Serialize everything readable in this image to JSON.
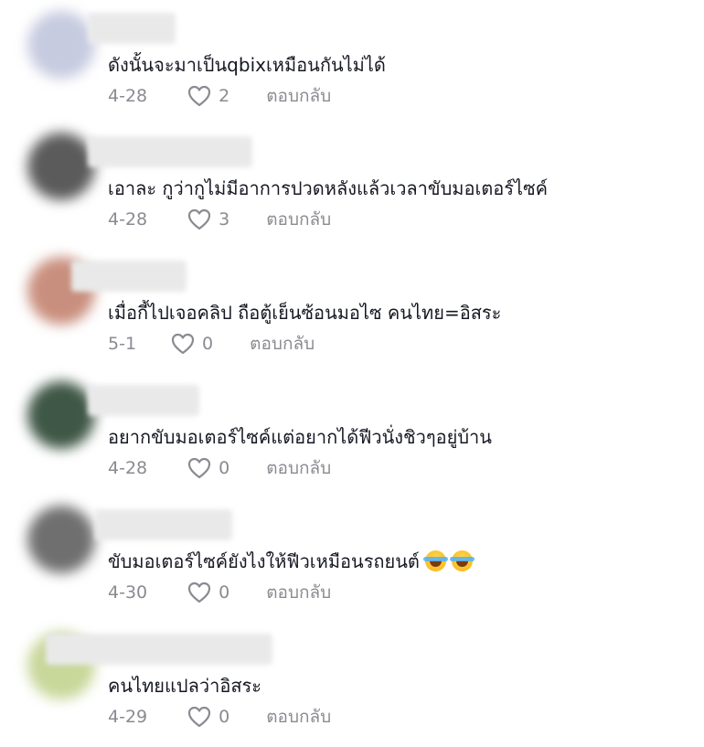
{
  "comments": [
    {
      "text": "ดังนั้นจะมาเป็นqbixเหมือนกันไม่ได้",
      "date": "4-28",
      "likes": "2",
      "reply": "ตอบกลับ"
    },
    {
      "text": "เอาละ กูว่ากูไม่มีอาการปวดหลังแล้วเวลาขับมอเตอร์ไซค์",
      "date": "4-28",
      "likes": "3",
      "reply": "ตอบกลับ"
    },
    {
      "text": "เมื่อกี้ไปเจอคลิป ถือตู้เย็นซ้อนมอไซ คนไทย=อิสระ",
      "date": "5-1",
      "likes": "0",
      "reply": "ตอบกลับ"
    },
    {
      "text": "อยากขับมอเตอร์ไซค์แต่อยากได้ฟีวนั่งชิวๆอยู่บ้าน",
      "date": "4-28",
      "likes": "0",
      "reply": "ตอบกลับ"
    },
    {
      "text": "ขับมอเตอร์ไซค์ยังไงให้ฟีวเหมือนรถยนต์",
      "date": "4-30",
      "likes": "0",
      "reply": "ตอบกลับ",
      "emoji": "face-with-tears-of-joy"
    },
    {
      "text": "คนไทยแปลว่าอิสระ",
      "date": "4-29",
      "likes": "0",
      "reply": "ตอบกลับ"
    }
  ],
  "colors": {
    "text": "#161823",
    "meta": "#8a8b91",
    "avatar_1": "#c7cbe0",
    "avatar_2": "#5b5b5b",
    "avatar_3": "#c98f7e",
    "avatar_4": "#3f5746",
    "avatar_5": "#6f6f6f",
    "avatar_6": "#c8d79a"
  }
}
